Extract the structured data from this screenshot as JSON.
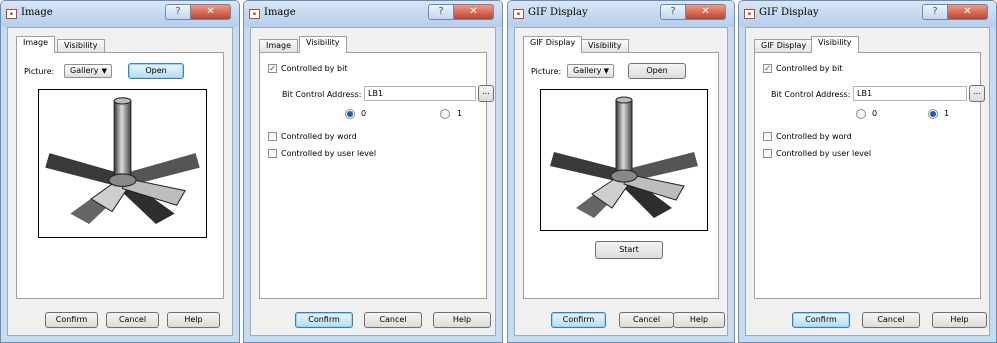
{
  "dialogs": [
    {
      "title": "Image",
      "tabs": [
        "Image",
        "Visibility"
      ],
      "active_tab": "Image",
      "picture_label": "Picture:",
      "picture_source": "Gallery",
      "open_label": "Open",
      "footer": {
        "confirm": "Confirm",
        "cancel": "Cancel",
        "help": "Help"
      }
    },
    {
      "title": "Image",
      "tabs": [
        "Image",
        "Visibility"
      ],
      "active_tab": "Visibility",
      "controlled_by_bit": "Controlled by bit",
      "controlled_by_bit_checked": true,
      "bit_address_label": "Bit Control Address:",
      "bit_address_value": "LB1",
      "browse_label": "...",
      "radio_0": "0",
      "radio_1": "1",
      "radio_selected": "0",
      "controlled_by_word": "Controlled by word",
      "controlled_by_user_level": "Controlled by user level",
      "footer": {
        "confirm": "Confirm",
        "cancel": "Cancel",
        "help": "Help"
      }
    },
    {
      "title": "GIF Display",
      "tabs": [
        "GIF Display",
        "Visibility"
      ],
      "active_tab": "GIF Display",
      "picture_label": "Picture:",
      "picture_source": "Gallery",
      "open_label": "Open",
      "start_label": "Start",
      "footer": {
        "confirm": "Confirm",
        "cancel": "Cancel",
        "help": "Help"
      }
    },
    {
      "title": "GIF Display",
      "tabs": [
        "GIF Display",
        "Visibility"
      ],
      "active_tab": "Visibility",
      "controlled_by_bit": "Controlled by bit",
      "controlled_by_bit_checked": true,
      "bit_address_label": "Bit Control Address:",
      "bit_address_value": "LB1",
      "browse_label": "...",
      "radio_0": "0",
      "radio_1": "1",
      "radio_selected": "1",
      "controlled_by_word": "Controlled by word",
      "controlled_by_user_level": "Controlled by user level",
      "footer": {
        "confirm": "Confirm",
        "cancel": "Cancel",
        "help": "Help"
      }
    }
  ],
  "title_buttons": {
    "help_glyph": "?",
    "close_glyph": "✕"
  },
  "icons": {
    "app": "app-icon",
    "dropdown": "chevron-down-icon",
    "check": "checkmark-icon"
  },
  "colors": {
    "titlebar": "#c7daf0",
    "close_button": "#c2402a",
    "radio_selected": "#1f5fb0",
    "focus_button": "#b7dcf4"
  }
}
